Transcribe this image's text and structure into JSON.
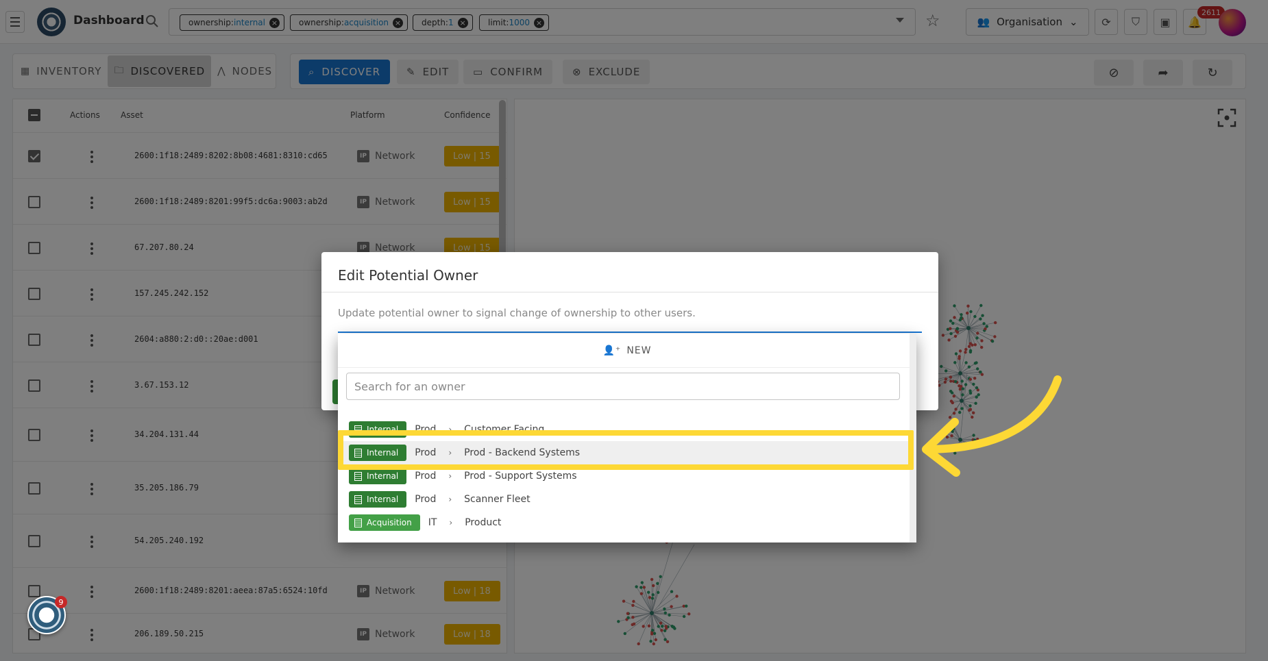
{
  "topbar": {
    "title": "Dashboard",
    "filters": [
      {
        "key": "ownership:",
        "value": "internal"
      },
      {
        "key": "ownership:",
        "value": "acquisition"
      },
      {
        "key": "depth:",
        "value": "1"
      },
      {
        "key": "limit:",
        "value": "1000"
      }
    ],
    "org_label": "Organisation",
    "notifications_count": "2611"
  },
  "view_tabs": [
    {
      "label": "INVENTORY",
      "icon": "grid-icon"
    },
    {
      "label": "DISCOVERED",
      "icon": "discovered-icon",
      "active": true
    },
    {
      "label": "NODES",
      "icon": "nodes-icon"
    }
  ],
  "actions": {
    "discover": "DISCOVER",
    "edit": "EDIT",
    "confirm": "CONFIRM",
    "exclude": "EXCLUDE"
  },
  "table": {
    "headers": {
      "actions": "Actions",
      "asset": "Asset",
      "platform": "Platform",
      "confidence": "Confidence"
    },
    "rows": [
      {
        "checked": true,
        "asset": "2600:1f18:2489:8202:8b08:4681:8310:cd65",
        "platform": "Network",
        "confidence": "Low | 15"
      },
      {
        "checked": false,
        "asset": "2600:1f18:2489:8201:99f5:dc6a:9003:ab2d",
        "platform": "Network",
        "confidence": "Low | 15"
      },
      {
        "checked": false,
        "asset": "67.207.80.24",
        "platform": "Network",
        "confidence": "Low | 15"
      },
      {
        "checked": false,
        "asset": "157.245.242.152",
        "platform": "",
        "confidence": ""
      },
      {
        "checked": false,
        "asset": "2604:a880:2:d0::20ae:d001",
        "platform": "",
        "confidence": ""
      },
      {
        "checked": false,
        "asset": "3.67.153.12",
        "platform": "",
        "confidence": ""
      },
      {
        "checked": false,
        "asset": "34.204.131.44",
        "platform": "",
        "confidence": ""
      },
      {
        "checked": false,
        "asset": "35.205.186.79",
        "platform": "",
        "confidence": ""
      },
      {
        "checked": false,
        "asset": "54.205.240.192",
        "platform": "",
        "confidence": ""
      },
      {
        "checked": false,
        "asset": "2600:1f18:2489:8201:aeea:87a5:6524:10fd",
        "platform": "Network",
        "confidence": "Low | 18"
      },
      {
        "checked": false,
        "asset": "206.189.50.215",
        "platform": "Network",
        "confidence": "Low | 18"
      }
    ]
  },
  "modal": {
    "title": "Edit Potential Owner",
    "description": "Update potential owner to signal change of ownership to other users."
  },
  "dropdown": {
    "new_label": "NEW",
    "search_placeholder": "Search for an owner",
    "options": [
      {
        "tag": "Internal",
        "parent": "Prod",
        "name": "Customer Facing",
        "highlighted": false
      },
      {
        "tag": "Internal",
        "parent": "Prod",
        "name": "Prod - Backend Systems",
        "highlighted": true
      },
      {
        "tag": "Internal",
        "parent": "Prod",
        "name": "Prod - Support Systems",
        "highlighted": false
      },
      {
        "tag": "Internal",
        "parent": "Prod",
        "name": "Scanner Fleet",
        "highlighted": false
      },
      {
        "tag": "Acquisition",
        "parent": "IT",
        "name": "Product",
        "highlighted": false
      }
    ]
  },
  "assistant_badge": "9",
  "colors": {
    "primary": "#1976d2",
    "internal_tag": "#2e7d32",
    "acquisition_tag": "#43a047",
    "confidence_low": "#f0b400",
    "callout_yellow": "#fdd835"
  }
}
